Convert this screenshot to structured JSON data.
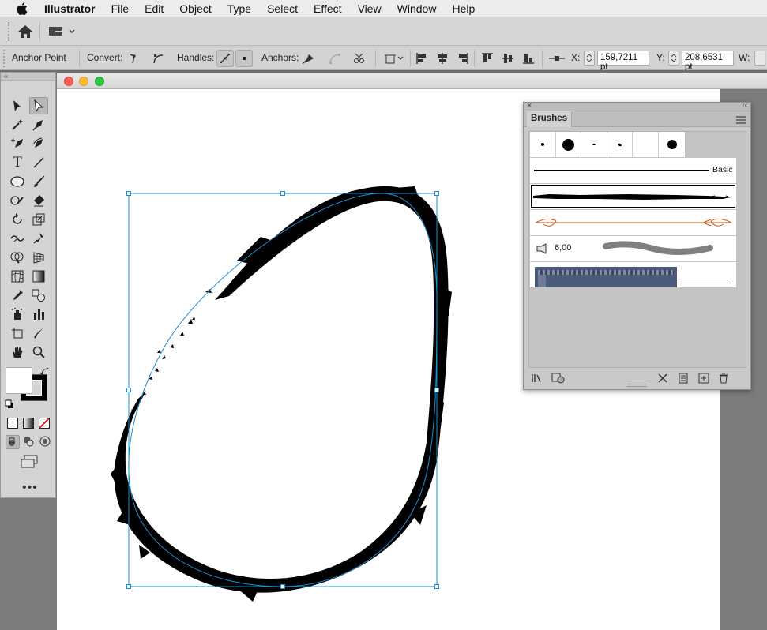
{
  "menubar": {
    "app_name": "Illustrator",
    "items": [
      "File",
      "Edit",
      "Object",
      "Type",
      "Select",
      "Effect",
      "View",
      "Window",
      "Help"
    ]
  },
  "control": {
    "selection_label": "Anchor Point",
    "convert_label": "Convert:",
    "handles_label": "Handles:",
    "anchors_label": "Anchors:",
    "x_label": "X:",
    "x_value": "159,7211 pt",
    "y_label": "Y:",
    "y_value": "208,6531 pt",
    "w_label": "W:"
  },
  "brushes_panel": {
    "tab_label": "Brushes",
    "basic_label": "Basic",
    "brush_size_value": "6,00"
  },
  "colors": {
    "selection": "#1a8fd1",
    "accent_brush": "#c35a1e"
  }
}
